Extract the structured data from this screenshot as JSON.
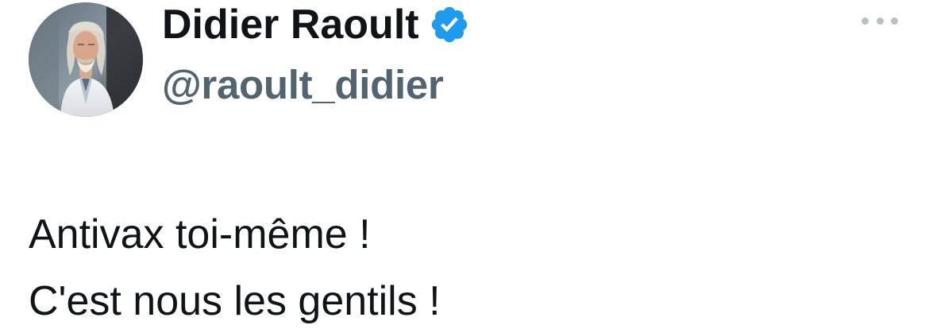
{
  "author": {
    "display_name": "Didier Raoult",
    "handle": "@raoult_didier",
    "verified": true,
    "avatar": "profile-photo"
  },
  "tweet": {
    "lines": [
      "Antivax toi-même !",
      "C'est nous les gentils !"
    ]
  },
  "icons": {
    "verified": "verified-badge-icon",
    "more": "more-options-icon"
  },
  "colors": {
    "text_primary": "#0f1419",
    "text_secondary": "#536471",
    "verified_blue": "#1d9bf0",
    "more_dots": "#b8c0c7",
    "background": "#ffffff"
  }
}
